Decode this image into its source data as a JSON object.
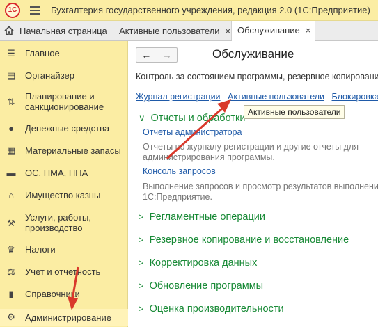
{
  "titlebar": {
    "logo_text": "1С",
    "title": "Бухгалтерия государственного учреждения, редакция 2.0  (1С:Предприятие)"
  },
  "tabs": [
    {
      "label": "Начальная страница"
    },
    {
      "label": "Активные пользователи",
      "close": "×"
    },
    {
      "label": "Обслуживание",
      "close": "×"
    }
  ],
  "sidebar": {
    "items": [
      {
        "label": "Главное",
        "icon": "menu-icon"
      },
      {
        "label": "Органайзер",
        "icon": "organizer-icon"
      },
      {
        "label": "Планирование и санкционирование",
        "icon": "planning-icon"
      },
      {
        "label": "Денежные средства",
        "icon": "money-icon"
      },
      {
        "label": "Материальные запасы",
        "icon": "stock-icon"
      },
      {
        "label": "ОС, НМА, НПА",
        "icon": "truck-icon"
      },
      {
        "label": "Имущество казны",
        "icon": "treasury-icon"
      },
      {
        "label": "Услуги, работы, производство",
        "icon": "tools-icon"
      },
      {
        "label": "Налоги",
        "icon": "eagle-icon"
      },
      {
        "label": "Учет и отчетность",
        "icon": "scales-icon"
      },
      {
        "label": "Справочники",
        "icon": "book-icon"
      },
      {
        "label": "Администрирование",
        "icon": "gear-icon"
      }
    ]
  },
  "main": {
    "nav": {
      "back": "←",
      "forward": "→"
    },
    "title": "Обслуживание",
    "description": "Контроль за состоянием программы, резервное копирование",
    "links": [
      "Журнал регистрации",
      "Активные пользователи",
      "Блокировка"
    ],
    "tooltip": "Активные пользователи",
    "groups": [
      {
        "label": "Отчеты и обработки",
        "chevron": "∨"
      },
      {
        "label": "Регламентные операции",
        "chevron": ">"
      },
      {
        "label": "Резервное копирование и восстановление",
        "chevron": ">"
      },
      {
        "label": "Корректировка данных",
        "chevron": ">"
      },
      {
        "label": "Обновление программы",
        "chevron": ">"
      },
      {
        "label": "Оценка производительности",
        "chevron": ">"
      }
    ],
    "reports": [
      {
        "link": "Отчеты администратора",
        "desc_lines": [
          "Отчеты по журналу регистрации и другие отчеты для",
          "администрирования программы."
        ]
      },
      {
        "link": "Консоль запросов",
        "desc_lines": [
          "Выполнение запросов и просмотр результатов выполнения",
          "1С:Предприятие."
        ]
      }
    ]
  },
  "colors": {
    "sidebar_bg": "#fbeda3",
    "link": "#1f5aa8",
    "group": "#188a36",
    "arrow": "#d9392b"
  }
}
